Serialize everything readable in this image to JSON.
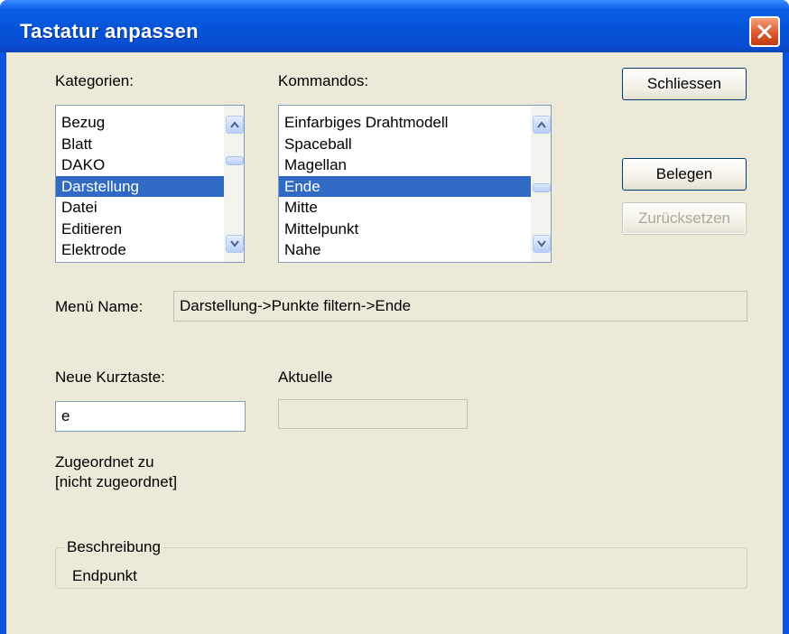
{
  "window": {
    "title": "Tastatur anpassen"
  },
  "categories": {
    "label": "Kategorien:",
    "items": [
      "Bezug",
      "Blatt",
      "DAKO",
      "Darstellung",
      "Datei",
      "Editieren",
      "Elektrode"
    ],
    "selected": "Darstellung"
  },
  "commands": {
    "label": "Kommandos:",
    "items": [
      "Einfarbiges Drahtmodell",
      "Spaceball",
      "Magellan",
      "Ende",
      "Mitte",
      "Mittelpunkt",
      "Nahe"
    ],
    "selected": "Ende"
  },
  "buttons": {
    "close": "Schliessen",
    "assign": "Belegen",
    "reset": "Zurücksetzen"
  },
  "menu_name": {
    "label": "Menü Name:",
    "value": "Darstellung->Punkte filtern->Ende"
  },
  "new_shortcut": {
    "label": "Neue Kurztaste:",
    "value": "e"
  },
  "current": {
    "label": "Aktuelle",
    "value": ""
  },
  "assigned": {
    "label": "Zugeordnet zu",
    "value": "[nicht zugeordnet]"
  },
  "description": {
    "legend": "Beschreibung",
    "value": "Endpunkt"
  },
  "colors": {
    "titlebar": "#0a5fe6",
    "dialog_bg": "#ece9d8",
    "selection": "#316ac5",
    "close_button": "#dc5a2e"
  }
}
